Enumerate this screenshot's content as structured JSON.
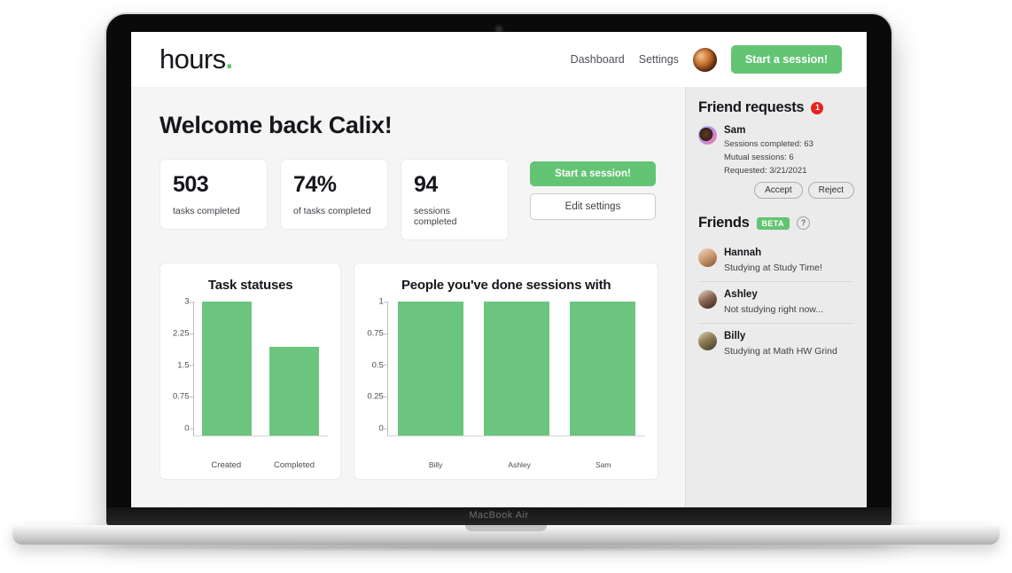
{
  "device": {
    "model_label": "MacBook Air"
  },
  "header": {
    "brand": "hours",
    "brand_dot": ".",
    "nav": [
      {
        "label": "Dashboard",
        "name": "dashboard"
      },
      {
        "label": "Settings",
        "name": "settings"
      }
    ],
    "avatar_name": "user-avatar",
    "cta_label": "Start a session!"
  },
  "main": {
    "welcome_title": "Welcome back Calix!",
    "stats": [
      {
        "value": "503",
        "label": "tasks completed"
      },
      {
        "value": "74%",
        "label": "of tasks completed"
      },
      {
        "value": "94",
        "label": "sessions completed"
      }
    ],
    "actions": {
      "start_session_label": "Start a session!",
      "edit_settings_label": "Edit settings"
    }
  },
  "chart_data": [
    {
      "type": "bar",
      "title": "Task statuses",
      "categories": [
        "Created",
        "Completed"
      ],
      "values": [
        3,
        2
      ],
      "xlabel": "",
      "ylabel": "",
      "ylim": [
        0,
        3
      ],
      "yticks": [
        "3",
        "2.25",
        "1.5",
        "0.75",
        "0"
      ],
      "grid": false,
      "legend": false,
      "bar_color": "#6cc57e"
    },
    {
      "type": "bar",
      "title": "People you've done sessions with",
      "categories": [
        "Billy",
        "Ashley",
        "Sam"
      ],
      "values": [
        1,
        1,
        1
      ],
      "xlabel": "",
      "ylabel": "",
      "ylim": [
        0,
        1
      ],
      "yticks": [
        "1",
        "0.75",
        "0.5",
        "0.25",
        "0"
      ],
      "grid": false,
      "legend": false,
      "bar_color": "#6cc57e"
    }
  ],
  "sidebar": {
    "friend_requests": {
      "title": "Friend requests",
      "badge_count": "1",
      "requests": [
        {
          "name": "Sam",
          "sessions_completed": "Sessions completed: 63",
          "mutual_sessions": "Mutual sessions: 6",
          "requested": "Requested: 3/21/2021",
          "accept_label": "Accept",
          "reject_label": "Reject"
        }
      ]
    },
    "friends": {
      "title": "Friends",
      "beta_label": "BETA",
      "help_glyph": "?",
      "list": [
        {
          "name": "Hannah",
          "status": "Studying at Study Time!"
        },
        {
          "name": "Ashley",
          "status": "Not studying right now..."
        },
        {
          "name": "Billy",
          "status": "Studying at Math HW Grind"
        }
      ]
    }
  },
  "colors": {
    "accent_green": "#63c474",
    "bar_green": "#6cc57e",
    "badge_red": "#e8201f",
    "page_bg": "#f5f5f5",
    "sidebar_bg": "#ebebeb"
  }
}
